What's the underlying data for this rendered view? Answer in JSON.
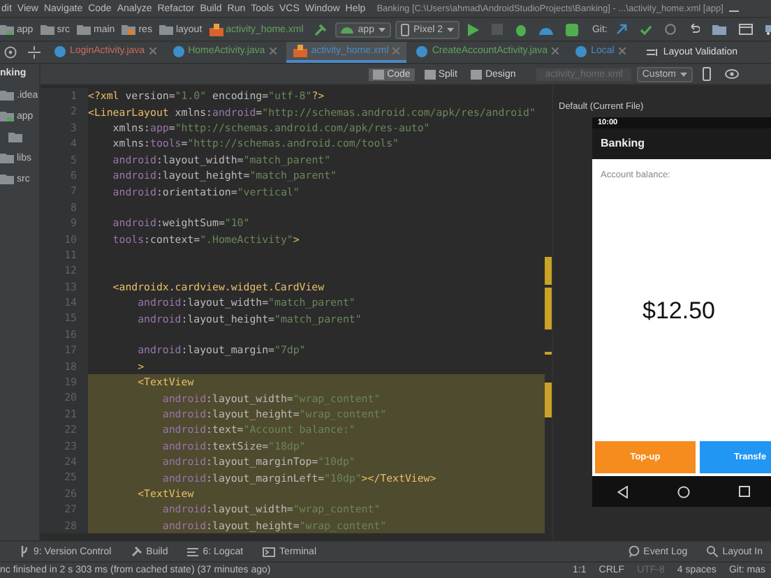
{
  "menu_bar": {
    "items": [
      "dit",
      "View",
      "Navigate",
      "Code",
      "Analyze",
      "Refactor",
      "Build",
      "Run",
      "Tools",
      "VCS",
      "Window",
      "Help"
    ],
    "title": "Banking [C:\\Users\\ahmad\\AndroidStudioProjects\\Banking] - ...\\activity_home.xml [app]"
  },
  "navigation_bar": {
    "breadcrumbs": [
      {
        "label": "app",
        "kind": "module"
      },
      {
        "label": "src",
        "kind": "folder"
      },
      {
        "label": "main",
        "kind": "folder"
      },
      {
        "label": "res",
        "kind": "res"
      },
      {
        "label": "layout",
        "kind": "folder"
      },
      {
        "label": "activity_home.xml",
        "kind": "xml"
      }
    ],
    "run_config": "app",
    "device": "Pixel 2",
    "git_label": "Git:"
  },
  "tabs": [
    {
      "label": "LoginActivity.java",
      "kind": "java",
      "color": "#cc6b5a",
      "selected": false
    },
    {
      "label": "HomeActivity.java",
      "kind": "java",
      "color": "#62a35c",
      "selected": false
    },
    {
      "label": "activity_home.xml",
      "kind": "xml",
      "color": "#4e8ac8",
      "selected": true
    },
    {
      "label": "CreateAccountActivity.java",
      "kind": "java",
      "color": "#62a35c",
      "selected": false
    },
    {
      "label": "Local",
      "kind": "local",
      "color": "#4e8ac8",
      "selected": false
    }
  ],
  "layout_validation": "Layout Validation",
  "project": {
    "title": "nking",
    "items": [
      {
        "label": ".idea",
        "kind": "folder"
      },
      {
        "label": "app",
        "kind": "module",
        "children": [
          {
            "kind": "folder"
          }
        ]
      },
      {
        "label": "libs",
        "kind": "folder"
      },
      {
        "label": "src",
        "kind": "folder"
      }
    ]
  },
  "view_modes": [
    {
      "label": "Code",
      "selected": true
    },
    {
      "label": "Split",
      "selected": false
    },
    {
      "label": "Design",
      "selected": false
    }
  ],
  "preview_file": {
    "value": "activity_home.xml",
    "disabled": true
  },
  "preview_device": "Custom",
  "editor": {
    "lines": [
      {
        "number": "1",
        "highlighted": false,
        "tokens": [
          {
            "kind": "tag",
            "text": "<?xml"
          },
          {
            "kind": "plain",
            "text": " version="
          },
          {
            "kind": "value",
            "text": "\"1.0\""
          },
          {
            "kind": "plain",
            "text": " encoding="
          },
          {
            "kind": "value",
            "text": "\"utf-8\""
          },
          {
            "kind": "tag",
            "text": "?>"
          }
        ]
      },
      {
        "number": "2",
        "highlighted": false,
        "tokens": [
          {
            "kind": "tag",
            "text": "<LinearLayout"
          },
          {
            "kind": "plain",
            "text": " xmlns:"
          },
          {
            "kind": "ns",
            "text": "android"
          },
          {
            "kind": "plain",
            "text": "="
          },
          {
            "kind": "value",
            "text": "\"http://schemas.android.com/apk/res/android\""
          }
        ]
      },
      {
        "number": "3",
        "highlighted": false,
        "tokens": [
          {
            "kind": "plain",
            "text": "    xmlns:"
          },
          {
            "kind": "ns",
            "text": "app"
          },
          {
            "kind": "plain",
            "text": "="
          },
          {
            "kind": "value",
            "text": "\"http://schemas.android.com/apk/res-auto\""
          }
        ]
      },
      {
        "number": "4",
        "highlighted": false,
        "tokens": [
          {
            "kind": "plain",
            "text": "    xmlns:"
          },
          {
            "kind": "ns",
            "text": "tools"
          },
          {
            "kind": "plain",
            "text": "="
          },
          {
            "kind": "value",
            "text": "\"http://schemas.android.com/tools\""
          }
        ]
      },
      {
        "number": "5",
        "highlighted": false,
        "tokens": [
          {
            "kind": "ns",
            "text": "    android"
          },
          {
            "kind": "plain",
            "text": ":layout_width="
          },
          {
            "kind": "value",
            "text": "\"match_parent\""
          }
        ]
      },
      {
        "number": "6",
        "highlighted": false,
        "tokens": [
          {
            "kind": "ns",
            "text": "    android"
          },
          {
            "kind": "plain",
            "text": ":layout_height="
          },
          {
            "kind": "value",
            "text": "\"match_parent\""
          }
        ]
      },
      {
        "number": "7",
        "highlighted": false,
        "tokens": [
          {
            "kind": "ns",
            "text": "    android"
          },
          {
            "kind": "plain",
            "text": ":orientation="
          },
          {
            "kind": "value",
            "text": "\"vertical\""
          }
        ]
      },
      {
        "number": "8",
        "highlighted": false
      },
      {
        "number": "9",
        "highlighted": false,
        "tokens": [
          {
            "kind": "ns",
            "text": "    android"
          },
          {
            "kind": "plain",
            "text": ":weightSum="
          },
          {
            "kind": "value",
            "text": "\"10\""
          }
        ]
      },
      {
        "number": "10",
        "highlighted": false,
        "tokens": [
          {
            "kind": "ns",
            "text": "    tools"
          },
          {
            "kind": "plain",
            "text": ":context="
          },
          {
            "kind": "value",
            "text": "\".HomeActivity\""
          },
          {
            "kind": "tag",
            "text": ">"
          }
        ]
      },
      {
        "number": "11",
        "highlighted": false
      },
      {
        "number": "12",
        "highlighted": false
      },
      {
        "number": "13",
        "highlighted": false,
        "tokens": [
          {
            "kind": "tag",
            "text": "    <androidx.cardview.widget.CardView"
          }
        ]
      },
      {
        "number": "14",
        "highlighted": false,
        "tokens": [
          {
            "kind": "ns",
            "text": "        android"
          },
          {
            "kind": "plain",
            "text": ":layout_width="
          },
          {
            "kind": "value",
            "text": "\"match_parent\""
          }
        ]
      },
      {
        "number": "15",
        "highlighted": false,
        "tokens": [
          {
            "kind": "ns",
            "text": "        android"
          },
          {
            "kind": "plain",
            "text": ":layout_height="
          },
          {
            "kind": "value",
            "text": "\"match_parent\""
          }
        ]
      },
      {
        "number": "16",
        "highlighted": false
      },
      {
        "number": "17",
        "highlighted": false,
        "tokens": [
          {
            "kind": "ns",
            "text": "        android"
          },
          {
            "kind": "plain",
            "text": ":layout_margin="
          },
          {
            "kind": "value",
            "text": "\"7dp\""
          }
        ]
      },
      {
        "number": "18",
        "highlighted": false,
        "tokens": [
          {
            "kind": "tag",
            "text": "        >"
          }
        ]
      },
      {
        "number": "19",
        "highlighted": true,
        "tokens": [
          {
            "kind": "tag",
            "text": "        <TextView"
          }
        ]
      },
      {
        "number": "20",
        "highlighted": true,
        "tokens": [
          {
            "kind": "ns",
            "text": "            android"
          },
          {
            "kind": "plain",
            "text": ":layout_width="
          },
          {
            "kind": "value",
            "text": "\"wrap_content\""
          }
        ]
      },
      {
        "number": "21",
        "highlighted": true,
        "tokens": [
          {
            "kind": "ns",
            "text": "            android"
          },
          {
            "kind": "plain",
            "text": ":layout_height="
          },
          {
            "kind": "value",
            "text": "\"wrap_content\""
          }
        ]
      },
      {
        "number": "22",
        "highlighted": true,
        "tokens": [
          {
            "kind": "ns",
            "text": "            android"
          },
          {
            "kind": "plain",
            "text": ":text="
          },
          {
            "kind": "value",
            "text": "\"Account balance:\""
          }
        ]
      },
      {
        "number": "23",
        "highlighted": true,
        "tokens": [
          {
            "kind": "ns",
            "text": "            android"
          },
          {
            "kind": "plain",
            "text": ":textSize="
          },
          {
            "kind": "value",
            "text": "\"18dp\""
          }
        ]
      },
      {
        "number": "24",
        "highlighted": true,
        "tokens": [
          {
            "kind": "ns",
            "text": "            android"
          },
          {
            "kind": "plain",
            "text": ":layout_marginTop="
          },
          {
            "kind": "value",
            "text": "\"10dp\""
          }
        ]
      },
      {
        "number": "25",
        "highlighted": true,
        "tokens": [
          {
            "kind": "ns",
            "text": "            android"
          },
          {
            "kind": "plain",
            "text": ":layout_marginLeft="
          },
          {
            "kind": "value",
            "text": "\"10dp\""
          },
          {
            "kind": "tag",
            "text": "></TextView>"
          }
        ]
      },
      {
        "number": "26",
        "highlighted": true,
        "tokens": [
          {
            "kind": "tag",
            "text": "        <TextView"
          }
        ]
      },
      {
        "number": "27",
        "highlighted": true,
        "tokens": [
          {
            "kind": "ns",
            "text": "            android"
          },
          {
            "kind": "plain",
            "text": ":layout_width="
          },
          {
            "kind": "value",
            "text": "\"wrap_content\""
          }
        ]
      },
      {
        "number": "28",
        "highlighted": true,
        "tokens": [
          {
            "kind": "ns",
            "text": "            android"
          },
          {
            "kind": "plain",
            "text": ":layout_height="
          },
          {
            "kind": "value",
            "text": "\"wrap_content\""
          }
        ]
      }
    ]
  },
  "preview": {
    "title": "Default (Current File)",
    "status_time": "10:00",
    "app_title": "Banking",
    "balance_label": "Account balance:",
    "balance": "$12.50",
    "buttons": [
      {
        "label": "Top-up",
        "color": "#f68c1e"
      },
      {
        "label": "Transfe",
        "color": "#2196f3"
      }
    ]
  },
  "tool_windows": {
    "left": [
      {
        "label": "9: Version Control",
        "kind": "vcs"
      },
      {
        "label": "Build",
        "kind": "build"
      },
      {
        "label": "6: Logcat",
        "kind": "logcat"
      },
      {
        "label": "Terminal",
        "kind": "terminal"
      }
    ],
    "right": [
      {
        "label": "Event Log",
        "kind": "log"
      },
      {
        "label": "Layout In",
        "kind": "inspector"
      }
    ]
  },
  "status_bar": {
    "message": "nc finished in 2 s 303 ms (from cached state) (37 minutes ago)",
    "position": "1:1",
    "line_separator": "CRLF",
    "encoding": {
      "value": "UTF-8",
      "disabled": true
    },
    "indent": "4 spaces",
    "vcs": "Git: mas"
  }
}
